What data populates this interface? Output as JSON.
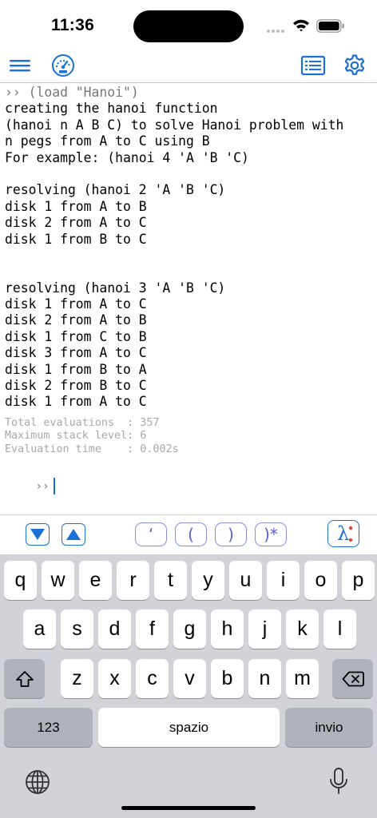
{
  "status_bar": {
    "time": "11:36"
  },
  "toolbar": {
    "menu_icon": "hamburger-icon",
    "gauge_icon": "gauge-icon",
    "list_icon": "document-list-icon",
    "settings_icon": "gear-icon",
    "accent_color": "#1a6fd8"
  },
  "console": {
    "lines": [
      {
        "kind": "input",
        "text": "›› (load \"Hanoi\")"
      },
      {
        "kind": "output",
        "text": "creating the hanoi function"
      },
      {
        "kind": "output",
        "text": "(hanoi n A B C) to solve Hanoi problem with"
      },
      {
        "kind": "output",
        "text": "n pegs from A to C using B"
      },
      {
        "kind": "output",
        "text": "For example: (hanoi 4 'A 'B 'C)"
      },
      {
        "kind": "output",
        "text": ""
      },
      {
        "kind": "output",
        "text": "resolving (hanoi 2 'A 'B 'C)"
      },
      {
        "kind": "output",
        "text": "disk 1 from A to B"
      },
      {
        "kind": "output",
        "text": "disk 2 from A to C"
      },
      {
        "kind": "output",
        "text": "disk 1 from B to C"
      },
      {
        "kind": "output",
        "text": ""
      },
      {
        "kind": "output",
        "text": ""
      },
      {
        "kind": "output",
        "text": "resolving (hanoi 3 'A 'B 'C)"
      },
      {
        "kind": "output",
        "text": "disk 1 from A to C"
      },
      {
        "kind": "output",
        "text": "disk 2 from A to B"
      },
      {
        "kind": "output",
        "text": "disk 1 from C to B"
      },
      {
        "kind": "output",
        "text": "disk 3 from A to C"
      },
      {
        "kind": "output",
        "text": "disk 1 from B to A"
      },
      {
        "kind": "output",
        "text": "disk 2 from B to C"
      },
      {
        "kind": "output",
        "text": "disk 1 from A to C"
      }
    ],
    "stats": [
      "Total evaluations  : 357",
      "Maximum stack level: 6",
      "Evaluation time    : 0.002s"
    ],
    "prompt": "››"
  },
  "accessory": {
    "down_icon": "triangle-down-icon",
    "up_icon": "triangle-up-icon",
    "quote_label": "‘",
    "open_paren_label": "(",
    "close_paren_label": ")",
    "close_all_label": ")*",
    "lambda_icon": "lambda-icon",
    "lambda_glyph": "λ"
  },
  "keyboard": {
    "row1": [
      "q",
      "w",
      "e",
      "r",
      "t",
      "y",
      "u",
      "i",
      "o",
      "p"
    ],
    "row2": [
      "a",
      "s",
      "d",
      "f",
      "g",
      "h",
      "j",
      "k",
      "l"
    ],
    "row3": [
      "z",
      "x",
      "c",
      "v",
      "b",
      "n",
      "m"
    ],
    "numbers_label": "123",
    "space_label": "spazio",
    "return_label": "invio",
    "shift_icon": "shift-icon",
    "delete_icon": "delete-icon",
    "globe_icon": "globe-icon",
    "mic_icon": "microphone-icon"
  }
}
